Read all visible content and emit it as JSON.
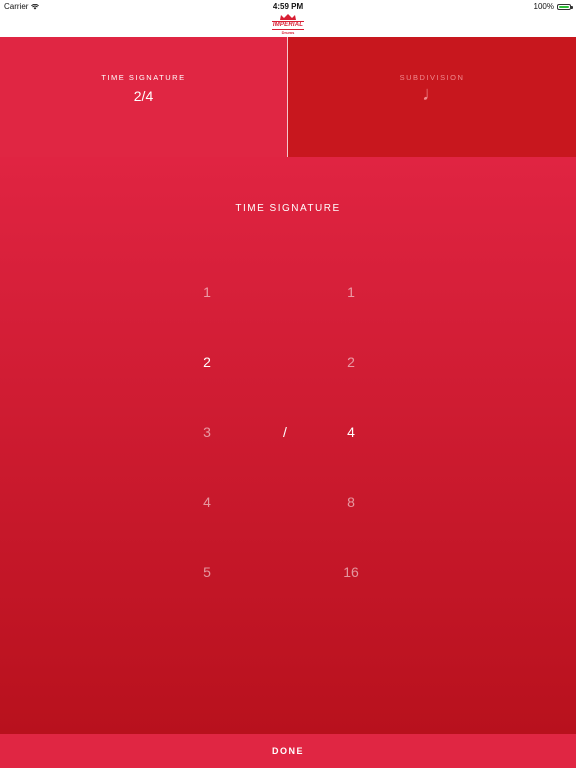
{
  "status_bar": {
    "carrier": "Carrier",
    "time": "4:59 PM",
    "battery": "100%"
  },
  "logo": {
    "brand": "IMPERIAL",
    "sub": "Drums"
  },
  "segments": {
    "time_signature_label": "TIME SIGNATURE",
    "time_signature_value": "2/4",
    "subdivision_label": "SUBDIVISION",
    "subdivision_value": "♩"
  },
  "picker": {
    "title": "TIME SIGNATURE",
    "numerators": [
      "1",
      "2",
      "3",
      "4",
      "5"
    ],
    "denominators": [
      "1",
      "2",
      "4",
      "8",
      "16"
    ],
    "selected_numerator": "2",
    "selected_denominator": "4",
    "separator": "/"
  },
  "done_label": "DONE",
  "colors": {
    "brand_red": "#e02643",
    "dark_red": "#c8171e",
    "battery_green": "#2fbf3a"
  }
}
